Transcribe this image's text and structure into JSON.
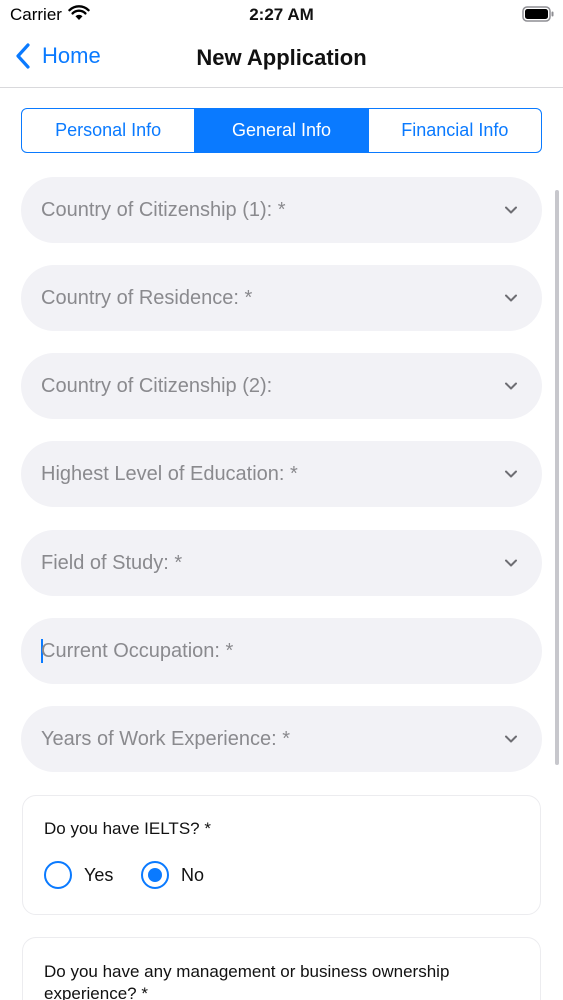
{
  "status_bar": {
    "carrier": "Carrier",
    "time": "2:27 AM"
  },
  "nav": {
    "back_label": "Home",
    "title": "New Application"
  },
  "tabs": [
    {
      "label": "Personal Info",
      "active": false
    },
    {
      "label": "General Info",
      "active": true
    },
    {
      "label": "Financial Info",
      "active": false
    }
  ],
  "fields": [
    {
      "label": "Country of Citizenship (1): *",
      "type": "dropdown"
    },
    {
      "label": "Country of Residence: *",
      "type": "dropdown"
    },
    {
      "label": "Country of Citizenship (2):",
      "type": "dropdown"
    },
    {
      "label": "Highest Level of Education: *",
      "type": "dropdown"
    },
    {
      "label": "Field of Study: *",
      "type": "dropdown"
    },
    {
      "placeholder": "Current Occupation: *",
      "type": "text",
      "focused": true
    },
    {
      "label": "Years of Work Experience: *",
      "type": "dropdown"
    }
  ],
  "ielts": {
    "question": "Do you have IELTS? *",
    "options": [
      {
        "label": "Yes",
        "selected": false
      },
      {
        "label": "No",
        "selected": true
      }
    ]
  },
  "management": {
    "question": "Do you have any management or business ownership experience? *"
  },
  "colors": {
    "accent": "#0a7aff",
    "field_bg": "#f2f2f6",
    "placeholder": "#8a8a8e"
  }
}
